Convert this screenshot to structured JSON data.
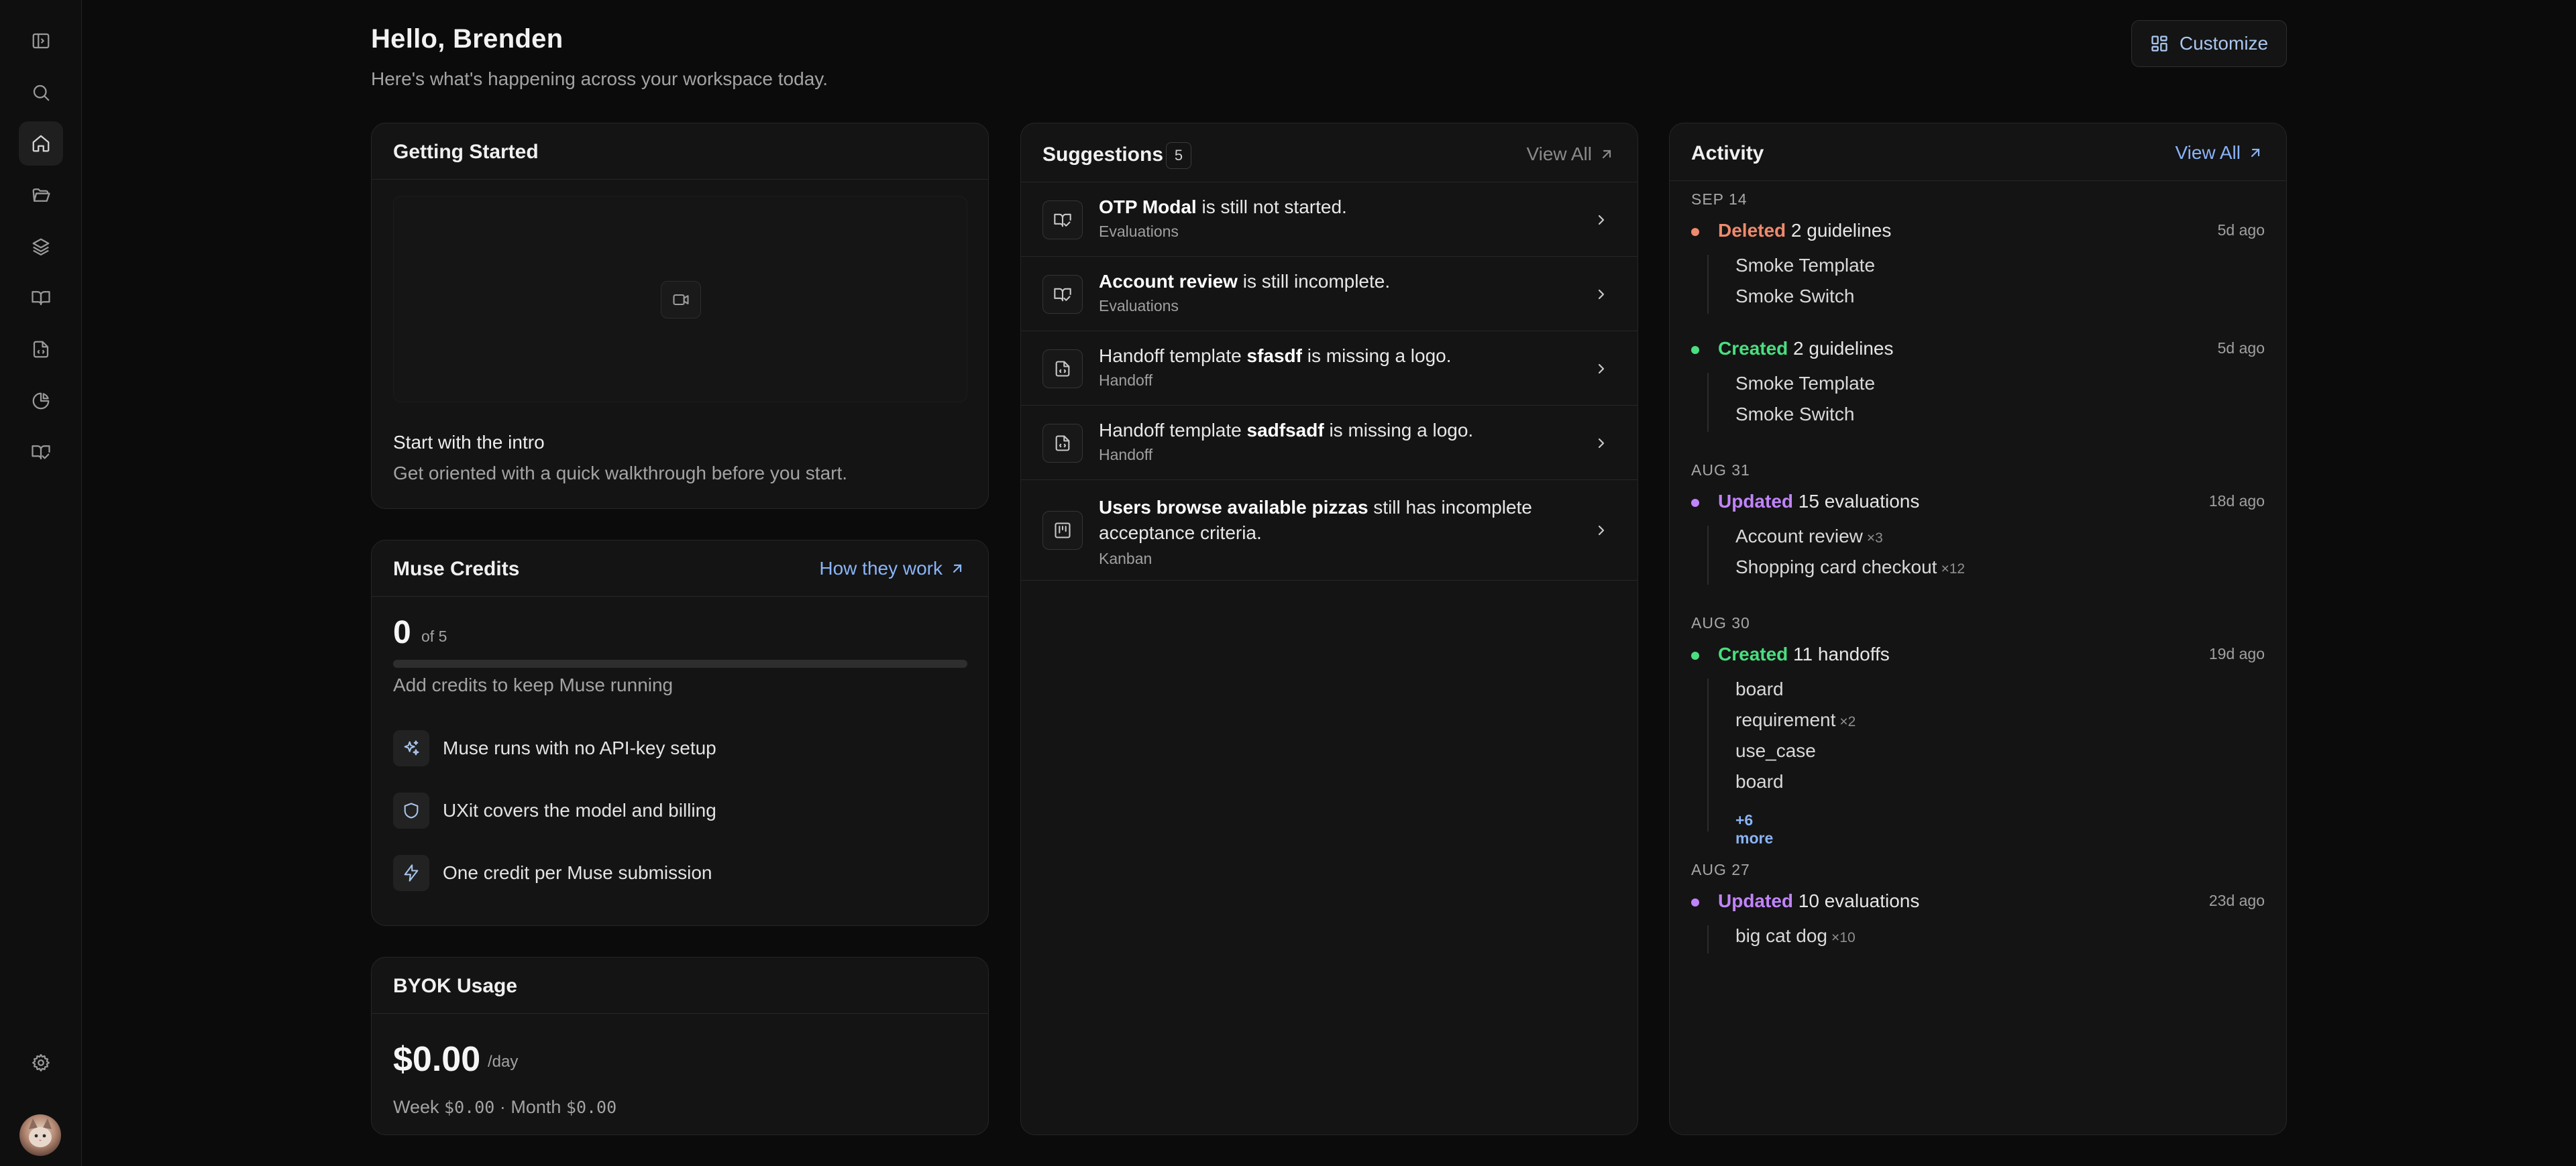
{
  "colors": {
    "accent": "#8ab4f8",
    "deleted": "#ef8a6c",
    "created": "#4ade80",
    "updated": "#c084fc"
  },
  "sidebar": {
    "items": [
      {
        "name": "toggle-sidebar",
        "icon": "sidebar-icon"
      },
      {
        "name": "search",
        "icon": "search-icon"
      },
      {
        "name": "home",
        "icon": "home-icon",
        "active": true
      },
      {
        "name": "projects",
        "icon": "folder-open-icon"
      },
      {
        "name": "layers",
        "icon": "layers-icon"
      },
      {
        "name": "guidelines",
        "icon": "book-open-icon"
      },
      {
        "name": "handoff",
        "icon": "file-code-icon"
      },
      {
        "name": "analytics",
        "icon": "pie-chart-icon"
      },
      {
        "name": "evaluations",
        "icon": "book-check-icon"
      }
    ],
    "settings_icon": "gear-icon",
    "avatar": "user-avatar"
  },
  "header": {
    "greeting": "Hello, Brenden",
    "subtitle": "Here's what's happening across your workspace today.",
    "customize_label": "Customize"
  },
  "getting_started": {
    "title": "Getting Started",
    "video_icon": "video-icon",
    "item_title": "Start with the intro",
    "item_desc": "Get oriented with a quick walkthrough before you start."
  },
  "muse_credits": {
    "title": "Muse Credits",
    "link_label": "How they work",
    "used": "0",
    "of_label": "of 5",
    "progress_fraction": 0,
    "note": "Add credits to keep Muse running",
    "features": [
      {
        "icon": "sparkles-icon",
        "text": "Muse runs with no API-key setup"
      },
      {
        "icon": "shield-icon",
        "text": "UXit covers the model and billing"
      },
      {
        "icon": "zap-icon",
        "text": "One credit per Muse submission"
      }
    ]
  },
  "byok": {
    "title": "BYOK Usage",
    "amount": "$0.00",
    "per": "/day",
    "week_label": "Week",
    "week_value": "$0.00",
    "separator": "·",
    "month_label": "Month",
    "month_value": "$0.00"
  },
  "suggestions": {
    "title": "Suggestions",
    "count": "5",
    "view_all": "View All",
    "items": [
      {
        "icon": "book-check-icon",
        "pre": "",
        "bold": "OTP Modal",
        "post": " is still not started.",
        "sub": "Evaluations"
      },
      {
        "icon": "book-check-icon",
        "pre": "",
        "bold": "Account review",
        "post": " is still incomplete.",
        "sub": "Evaluations"
      },
      {
        "icon": "file-code-icon",
        "pre": "Handoff template ",
        "bold": "sfasdf",
        "post": " is missing a logo.",
        "sub": "Handoff"
      },
      {
        "icon": "file-code-icon",
        "pre": "Handoff template ",
        "bold": "sadfsadf",
        "post": " is missing a logo.",
        "sub": "Handoff"
      },
      {
        "icon": "kanban-icon",
        "pre": "",
        "bold": "Users browse available pizzas",
        "post": " still has incomplete acceptance criteria.",
        "sub": "Kanban"
      }
    ]
  },
  "activity": {
    "title": "Activity",
    "view_all": "View All",
    "groups": [
      {
        "date": "SEP 14",
        "entries": [
          {
            "verb": "Deleted",
            "rest": " 2 guidelines",
            "time": "5d ago",
            "kind": "deleted",
            "items": [
              {
                "label": "Smoke Template",
                "mult": ""
              },
              {
                "label": "Smoke Switch",
                "mult": ""
              }
            ]
          },
          {
            "verb": "Created",
            "rest": " 2 guidelines",
            "time": "5d ago",
            "kind": "created",
            "items": [
              {
                "label": "Smoke Template",
                "mult": ""
              },
              {
                "label": "Smoke Switch",
                "mult": ""
              }
            ]
          }
        ]
      },
      {
        "date": "AUG 31",
        "entries": [
          {
            "verb": "Updated",
            "rest": " 15 evaluations",
            "time": "18d ago",
            "kind": "updated",
            "items": [
              {
                "label": "Account review",
                "mult": "×3"
              },
              {
                "label": "Shopping card checkout",
                "mult": "×12"
              }
            ]
          }
        ]
      },
      {
        "date": "AUG 30",
        "entries": [
          {
            "verb": "Created",
            "rest": " 11 handoffs",
            "time": "19d ago",
            "kind": "created",
            "items": [
              {
                "label": "board",
                "mult": ""
              },
              {
                "label": "requirement",
                "mult": "×2"
              },
              {
                "label": "use_case",
                "mult": ""
              },
              {
                "label": "board",
                "mult": ""
              }
            ],
            "more": "+6 more"
          }
        ]
      },
      {
        "date": "AUG 27",
        "entries": [
          {
            "verb": "Updated",
            "rest": " 10 evaluations",
            "time": "23d ago",
            "kind": "updated",
            "items": [
              {
                "label": "big cat dog",
                "mult": "×10"
              }
            ]
          }
        ]
      }
    ]
  }
}
